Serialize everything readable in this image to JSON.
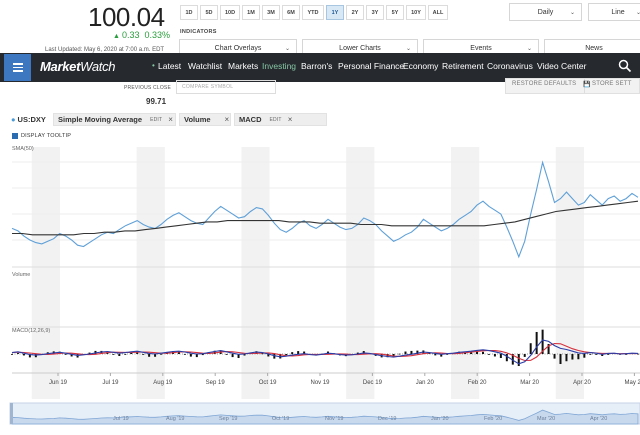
{
  "quote": {
    "price": "100.04",
    "change": "0.33",
    "change_pct": "0.33%",
    "last_updated": "Last Updated: May 6, 2020 at 7:00 a.m. EDT",
    "prev_close_label": "PREVIOUS CLOSE",
    "prev_close_value": "99.71",
    "up_color": "#2a9d3c"
  },
  "ranges": [
    "1D",
    "5D",
    "10D",
    "1M",
    "3M",
    "6M",
    "YTD",
    "1Y",
    "2Y",
    "3Y",
    "5Y",
    "10Y",
    "ALL"
  ],
  "active_range": "1Y",
  "frequency": "Daily",
  "chart_style": "Line",
  "indicators": {
    "label": "INDICATORS",
    "overlays": "Chart Overlays",
    "lower": "Lower Charts",
    "events": "Events",
    "news": "News"
  },
  "nav": {
    "logo_market": "Market",
    "logo_watch": "Watch",
    "items": [
      "Latest",
      "Watchlist",
      "Markets",
      "Investing",
      "Barron's",
      "Personal Finance",
      "Economy",
      "Retirement",
      "Coronavirus",
      "Video Center"
    ],
    "active": "Investing",
    "bg": "#26292e",
    "menu_bg": "#3d77c0"
  },
  "compare_placeholder": "COMPARE SYMBOL",
  "toolbar": {
    "restore": "RESTORE DEFAULTS",
    "store": "STORE SETT"
  },
  "studies": {
    "ticker": "US:DXY",
    "sma": "Simple Moving Average",
    "volume": "Volume",
    "macd": "MACD",
    "edit": "EDIT",
    "close": "×"
  },
  "display_tooltip": "DISPLAY TOOLTIP",
  "chart_data": {
    "type": "line",
    "pane_labels": {
      "price": "SMA(50)",
      "volume": "Volume",
      "macd": "MACD(12,26,9)"
    },
    "x_ticks": [
      "Jun 19",
      "Jul 19",
      "Aug 19",
      "Sep 19",
      "Oct 19",
      "Nov 19",
      "Dec 19",
      "Jan 20",
      "Feb 20",
      "Mar 20",
      "Apr 20",
      "May 20"
    ],
    "navigator_ticks": [
      "Jul '19",
      "Aug '19",
      "Sep '19",
      "Oct '19",
      "Nov '19",
      "Dec '19",
      "Jan '20",
      "Feb '20",
      "Mar '20",
      "Apr '20"
    ],
    "price_color": "#5fa0d8",
    "sma_color": "#333333",
    "price": [
      97.6,
      97.4,
      97.0,
      96.7,
      96.5,
      96.4,
      96.6,
      96.8,
      97.2,
      97.0,
      96.7,
      96.3,
      96.2,
      96.5,
      96.8,
      97.1,
      97.3,
      97.2,
      97.5,
      97.8,
      98.0,
      98.2,
      97.9,
      97.7,
      97.6,
      97.9,
      98.3,
      98.6,
      98.8,
      98.5,
      98.2,
      98.0,
      97.9,
      98.4,
      98.9,
      99.3,
      99.0,
      98.7,
      98.4,
      98.5,
      98.9,
      99.2,
      99.1,
      98.6,
      98.0,
      97.5,
      97.3,
      97.6,
      98.0,
      98.2,
      97.8,
      97.6,
      97.9,
      98.3,
      98.0,
      97.7,
      97.5,
      97.6,
      97.9,
      98.4,
      98.2,
      97.9,
      97.4,
      97.0,
      96.6,
      96.8,
      97.1,
      97.3,
      97.7,
      98.3,
      98.0,
      97.7,
      97.4,
      97.6,
      97.9,
      98.3,
      98.6,
      98.9,
      99.4,
      99.7,
      99.3,
      99.0,
      98.7,
      97.7,
      96.6,
      95.4,
      96.6,
      98.7,
      100.6,
      102.7,
      101.2,
      99.6,
      99.9,
      100.4,
      99.9,
      99.4,
      99.6,
      100.2,
      99.8,
      99.4,
      99.9,
      100.1,
      99.7,
      99.9,
      100.3,
      100.0
    ],
    "sma": [
      97.2,
      97.2,
      97.1,
      97.1,
      97.1,
      97.1,
      97.1,
      97.2,
      97.2,
      97.3,
      97.3,
      97.4,
      97.4,
      97.5,
      97.6,
      97.7,
      97.8,
      97.9,
      98.0,
      98.1,
      98.1,
      98.2,
      98.2,
      98.2,
      98.2,
      98.2,
      98.2,
      98.1,
      98.1,
      98.1,
      98.0,
      98.0,
      98.0,
      98.0,
      97.9,
      97.9,
      97.9,
      97.8,
      97.8,
      97.8,
      97.8,
      97.8,
      97.8,
      97.8,
      97.8,
      97.8,
      97.8,
      97.9,
      98.0,
      98.1,
      98.3,
      98.5,
      98.7,
      98.9,
      99.0,
      99.1,
      99.2,
      99.3,
      99.4,
      99.5,
      99.6,
      99.7
    ],
    "macd_line_color": "#2b3ea8",
    "macd_signal_color": "#d6313d",
    "macd": [
      0.05,
      0.08,
      0.03,
      -0.02,
      -0.04,
      -0.02,
      0.01,
      0.04,
      0.06,
      0.03,
      -0.01,
      -0.05,
      -0.03,
      0.0,
      0.04,
      0.07,
      0.09,
      0.06,
      0.03,
      0.05,
      0.08,
      0.1,
      0.06,
      0.02,
      0.0,
      0.03,
      0.06,
      0.09,
      0.1,
      0.07,
      0.03,
      0.0,
      0.01,
      0.05,
      0.09,
      0.12,
      0.08,
      0.03,
      -0.01,
      0.0,
      0.04,
      0.07,
      0.05,
      0.0,
      -0.06,
      -0.1,
      -0.08,
      -0.04,
      -0.01,
      0.01,
      -0.02,
      -0.04,
      -0.01,
      0.03,
      0.01,
      -0.02,
      -0.04,
      -0.03,
      0.0,
      0.04,
      0.02,
      -0.02,
      -0.06,
      -0.09,
      -0.11,
      -0.08,
      -0.04,
      -0.01,
      0.03,
      0.07,
      0.05,
      0.02,
      -0.01,
      0.01,
      0.03,
      0.06,
      0.08,
      0.1,
      0.13,
      0.15,
      0.12,
      0.08,
      0.03,
      -0.08,
      -0.22,
      -0.35,
      -0.28,
      -0.05,
      0.25,
      0.5,
      0.45,
      0.3,
      0.2,
      0.16,
      0.1,
      0.04,
      0.02,
      0.05,
      0.03,
      -0.01,
      0.02,
      0.03,
      0.0,
      0.01,
      0.03,
      0.02
    ]
  }
}
